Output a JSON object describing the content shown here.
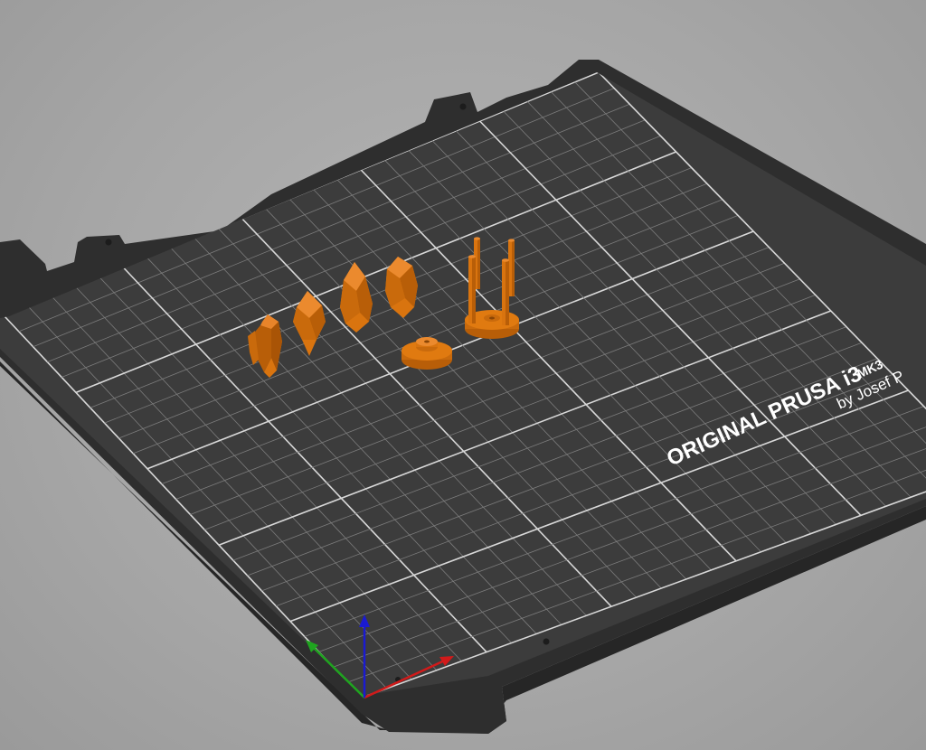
{
  "scene": {
    "bed_label": {
      "title": "ORIGINAL PRUSA i3",
      "model": "MK3",
      "subtitle": "by Josef P"
    },
    "objects": [
      {
        "name": "crystal-cluster"
      },
      {
        "name": "crystal"
      },
      {
        "name": "crystal"
      },
      {
        "name": "crystal"
      },
      {
        "name": "spool-base"
      },
      {
        "name": "stand-with-pegs"
      }
    ],
    "axes": [
      "x-axis",
      "y-axis",
      "z-axis"
    ],
    "colors": {
      "background": "#a8a8a8",
      "bed": "#3a3a3a",
      "bed_frame": "#2c2c2c",
      "grid_line": "#8a8a8a",
      "object": "#e07a10",
      "x_axis": "#d11a1a",
      "y_axis": "#1fa51f",
      "z_axis": "#1a1ad1"
    }
  }
}
